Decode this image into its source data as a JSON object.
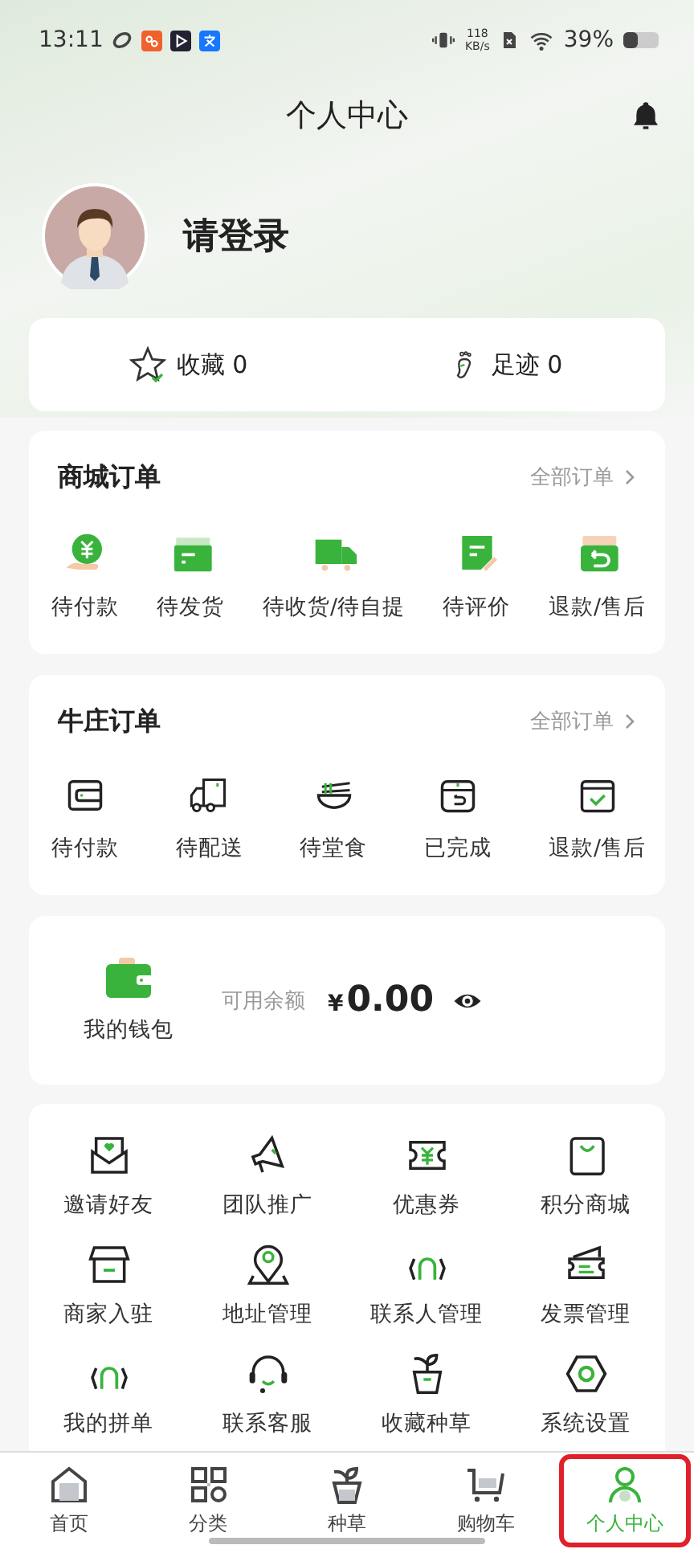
{
  "status_bar": {
    "time": "13:11",
    "net_speed": "118",
    "net_unit": "KB/s",
    "battery": "39%"
  },
  "header": {
    "title": "个人中心"
  },
  "profile": {
    "name": "请登录"
  },
  "stats": [
    {
      "label": "收藏 0"
    },
    {
      "label": "足迹 0"
    }
  ],
  "mall_orders": {
    "title": "商城订单",
    "more": "全部订单",
    "items": [
      "待付款",
      "待发货",
      "待收货/待自提",
      "待评价",
      "退款/售后"
    ]
  },
  "farm_orders": {
    "title": "牛庄订单",
    "more": "全部订单",
    "items": [
      "待付款",
      "待配送",
      "待堂食",
      "已完成",
      "退款/售后"
    ]
  },
  "wallet": {
    "label": "我的钱包",
    "balance_label": "可用余额",
    "currency": "¥",
    "amount": "0.00"
  },
  "tools": [
    "邀请好友",
    "团队推广",
    "优惠券",
    "积分商城",
    "商家入驻",
    "地址管理",
    "联系人管理",
    "发票管理",
    "我的拼单",
    "联系客服",
    "收藏种草",
    "系统设置"
  ],
  "tab_bar": [
    {
      "label": "首页",
      "selected": false,
      "outlined": false
    },
    {
      "label": "分类",
      "selected": false,
      "outlined": false
    },
    {
      "label": "种草",
      "selected": false,
      "outlined": false
    },
    {
      "label": "购物车",
      "selected": false,
      "outlined": false
    },
    {
      "label": "个人中心",
      "selected": true,
      "outlined": true
    }
  ]
}
